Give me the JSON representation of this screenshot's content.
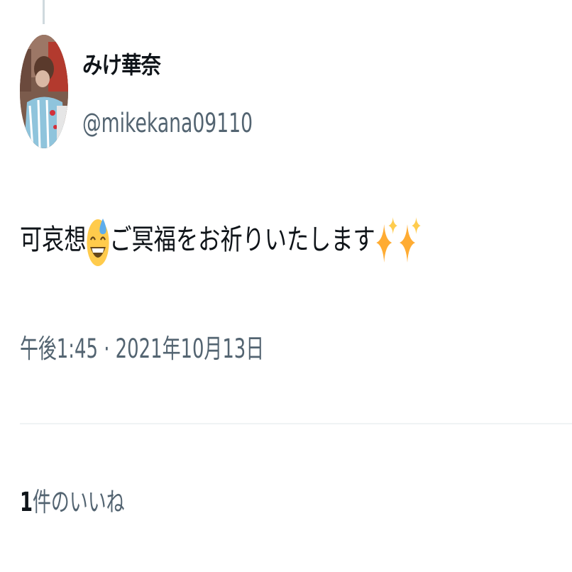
{
  "tweet": {
    "author": {
      "display_name": "みけ華奈",
      "handle": "@mikekana09110",
      "avatar": "profile-photo"
    },
    "text_before_emoji": "可哀想",
    "emoji_1": "grinning-face-with-sweat-emoji",
    "text_after_emoji": "ご冥福をお祈りいたします",
    "emoji_2": "sparkles-emoji",
    "timestamp": "午後1:45 · 2021年10月13日",
    "likes": {
      "count": "1",
      "label": "件のいいね"
    }
  }
}
